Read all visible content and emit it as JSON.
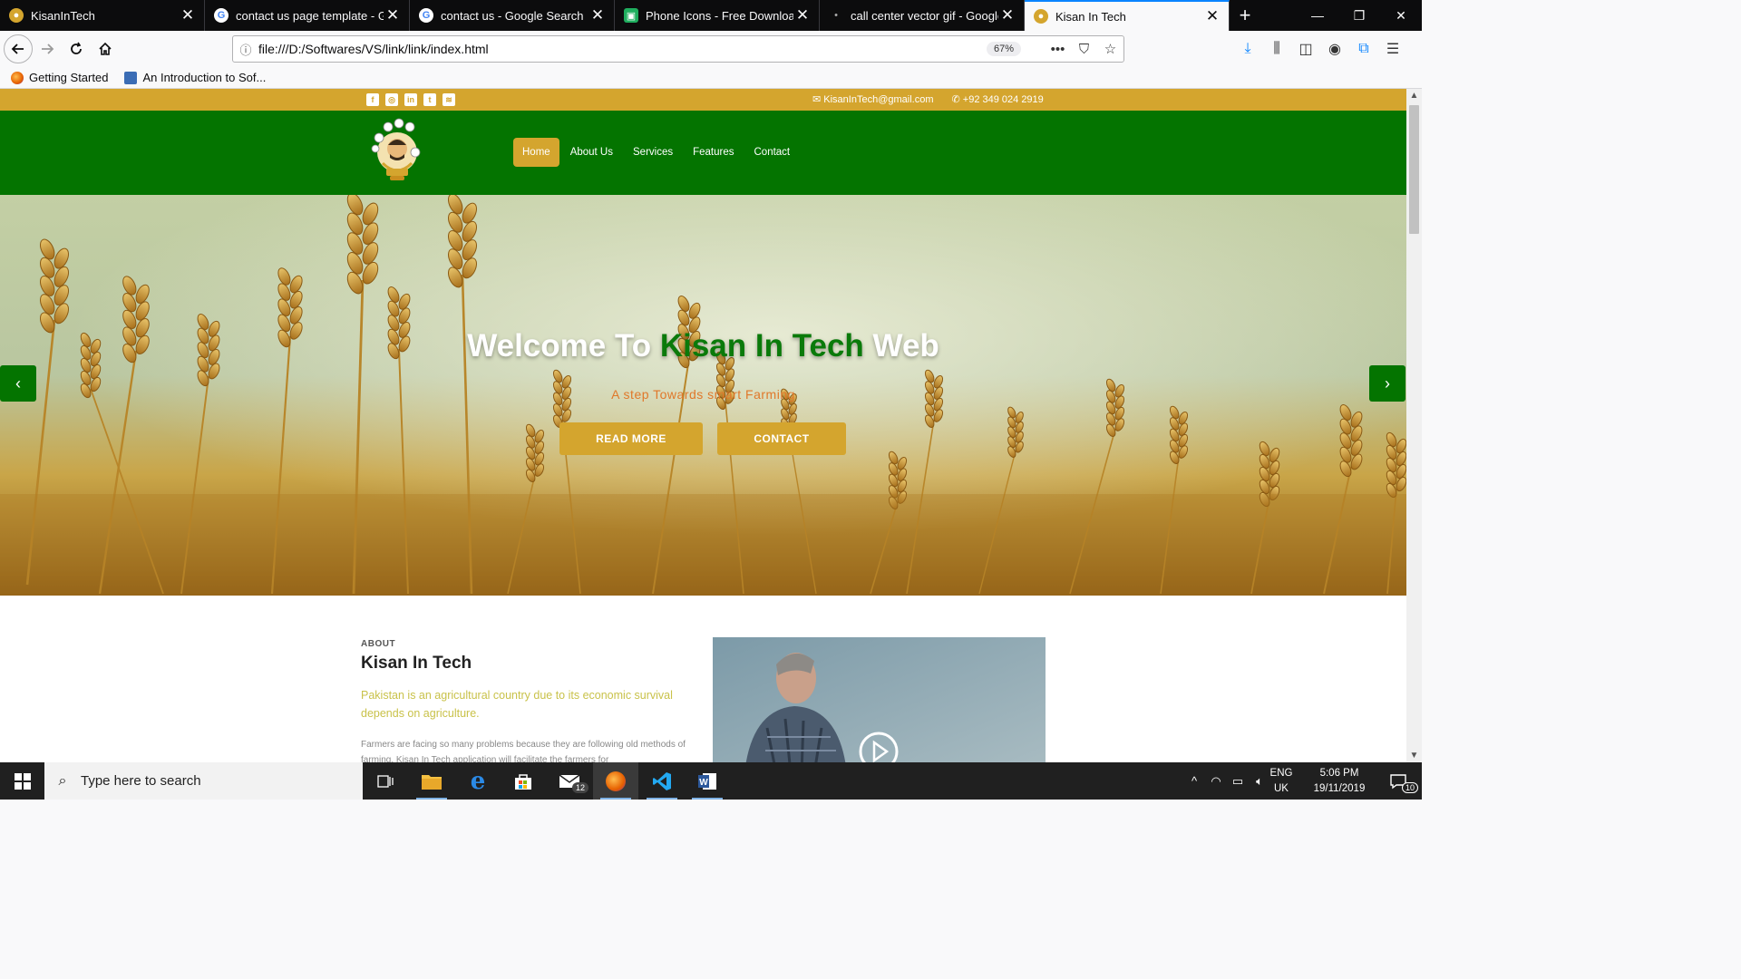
{
  "browser": {
    "tabs": [
      {
        "title": "KisanInTech",
        "favicon": "kisan-favicon",
        "active": false
      },
      {
        "title": "contact us page template - Go",
        "favicon": "google-favicon",
        "active": false
      },
      {
        "title": "contact us - Google Search",
        "favicon": "google-favicon",
        "active": false
      },
      {
        "title": "Phone Icons - Free Download,",
        "favicon": "flaticon-favicon",
        "active": false
      },
      {
        "title": "call center vector gif - Google",
        "favicon": "loading-dot",
        "active": false
      },
      {
        "title": "Kisan In Tech",
        "favicon": "kisan-favicon",
        "active": true
      }
    ],
    "url": "file:///D:/Softwares/VS/link/link/index.html",
    "zoom": "67%",
    "bookmarks": [
      {
        "label": "Getting Started"
      },
      {
        "label": "An Introduction to Sof..."
      }
    ]
  },
  "site": {
    "topbar": {
      "social_icons": [
        "facebook-icon",
        "instagram-icon",
        "linkedin-icon",
        "twitter-icon",
        "rss-icon"
      ],
      "email": "KisanInTech@gmail.com",
      "phone": "+92 349 024 2919"
    },
    "nav": {
      "items": [
        "Home",
        "About Us",
        "Services",
        "Features",
        "Contact"
      ],
      "active": "Home"
    },
    "hero": {
      "title_prefix": "Welcome To ",
      "title_highlight": "Kisan In Tech",
      "title_suffix": " Web",
      "subtitle": "A step Towards smart Farming",
      "btn_primary": "READ MORE",
      "btn_secondary": "CONTACT"
    },
    "about": {
      "kicker": "ABOUT",
      "title": "Kisan In Tech",
      "lead": "Pakistan is an agricultural country due to its economic survival depends on agriculture.",
      "body": "Farmers are facing so many problems because they are following old methods of farming. Kisan In Tech application will facilitate the farmers for"
    },
    "colors": {
      "gold": "#d4a52e",
      "green": "#047400",
      "subtitle_orange": "#e0782a",
      "lead_yellow": "#c9c24a"
    }
  },
  "taskbar": {
    "search_placeholder": "Type here to search",
    "mail_badge": "12",
    "language": "ENG",
    "region": "UK",
    "time": "5:06 PM",
    "date": "19/11/2019",
    "notification_count": "10"
  }
}
